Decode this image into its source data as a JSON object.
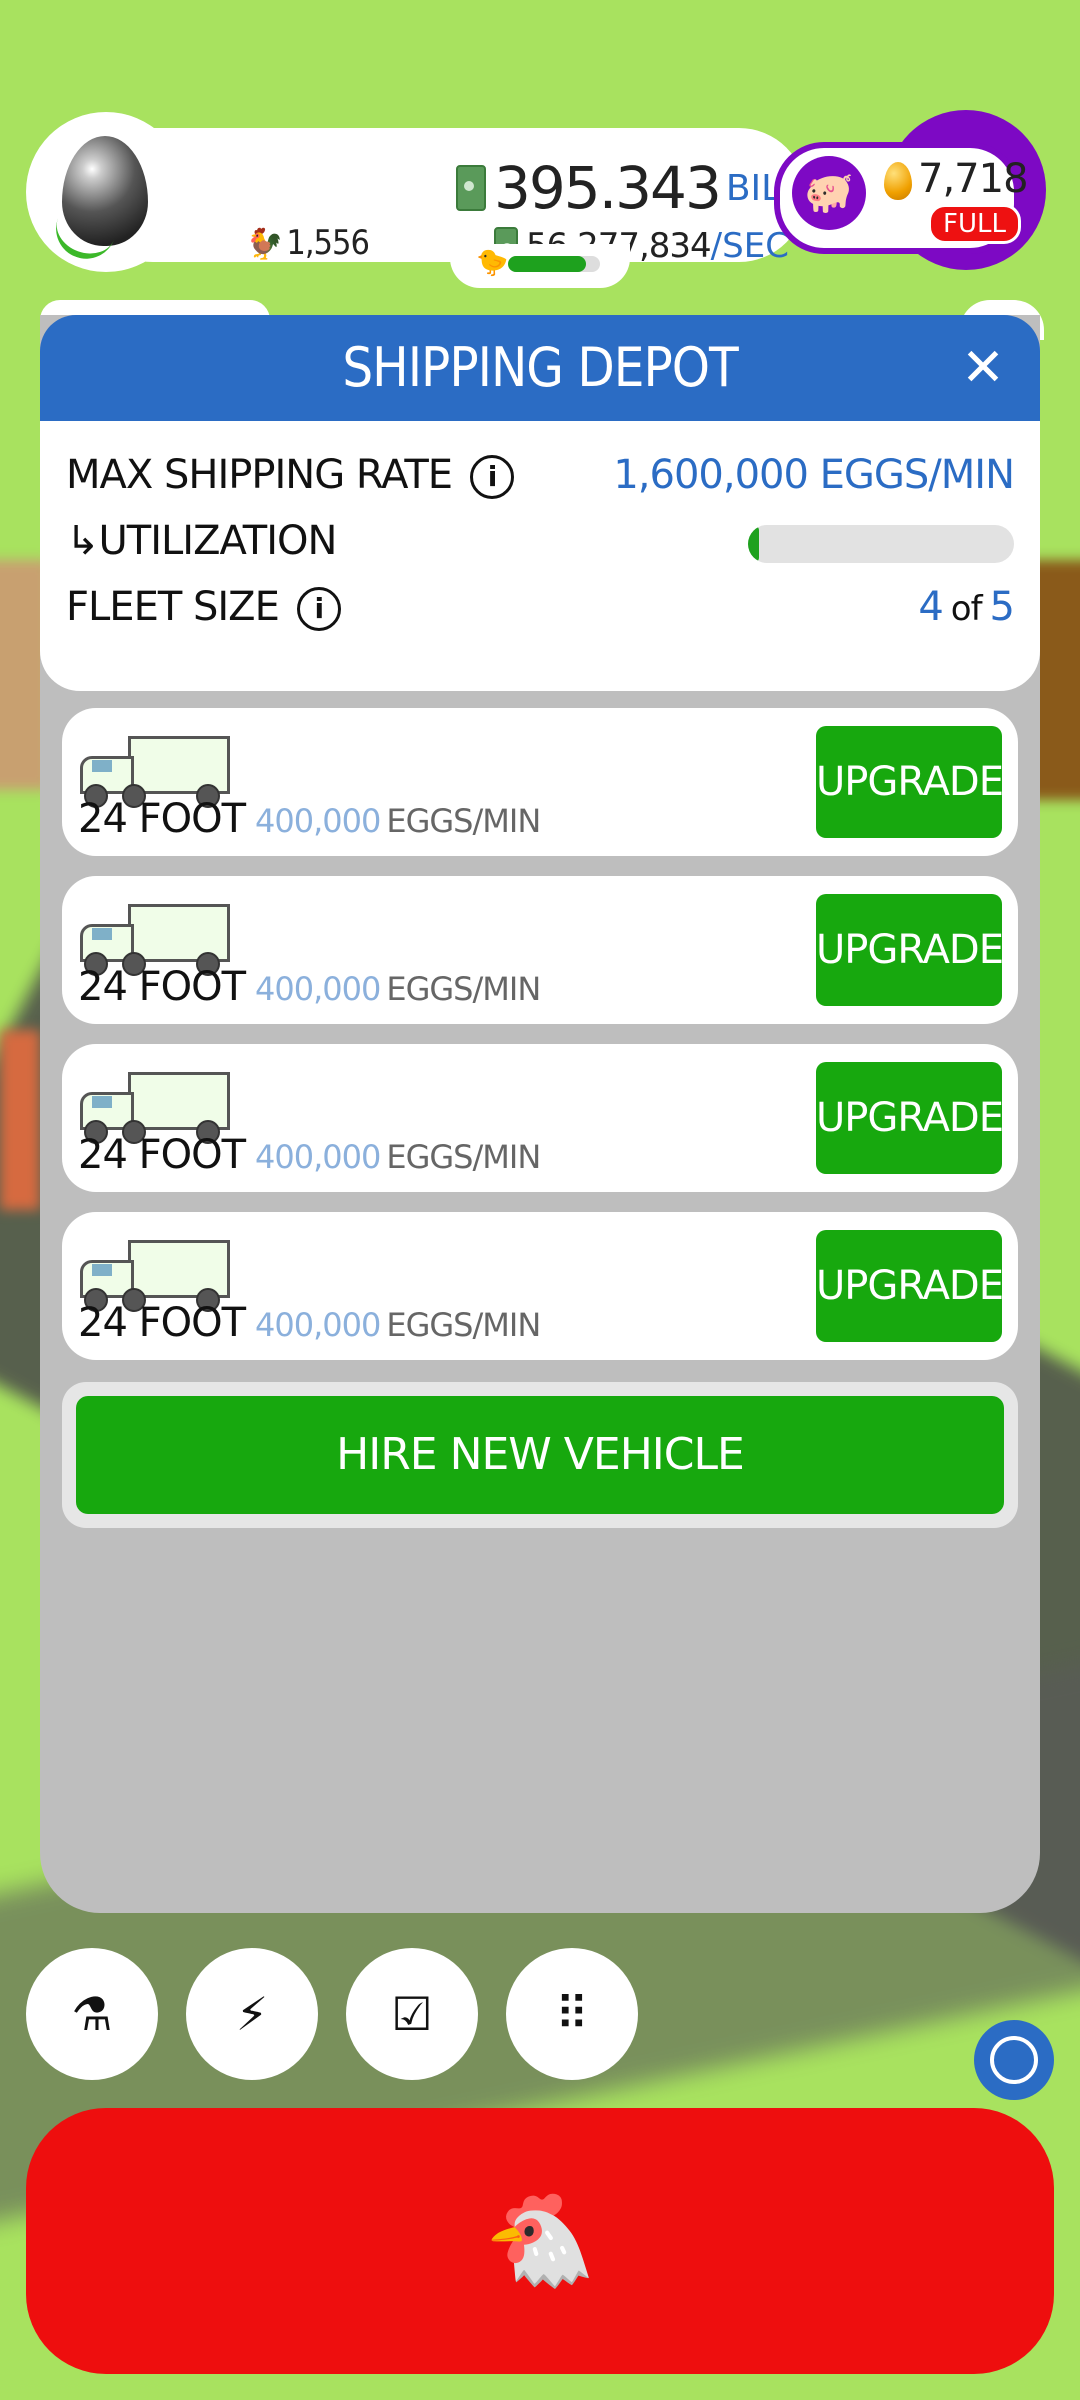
{
  "hud": {
    "chicken_count": "1,556",
    "money_value": "395.343",
    "money_unit": "BILLION",
    "rate_value": "56,277,834",
    "rate_unit": "/SEC",
    "golden_eggs": "7,718",
    "piggy_status": "FULL",
    "habitat_progress": 0.85
  },
  "modal": {
    "title": "SHIPPING DEPOT",
    "close_label": "✕",
    "max_rate_label": "MAX SHIPPING RATE",
    "max_rate_value": "1,600,000 EGGS/MIN",
    "utilization_label": "↳UTILIZATION",
    "utilization_fraction": 0.02,
    "fleet_label": "FLEET SIZE",
    "fleet_current": "4",
    "fleet_of": "of",
    "fleet_max": "5",
    "info_icon": "i",
    "vehicles": [
      {
        "name": "24 FOOT",
        "rate": "400,000",
        "unit": "EGGS/MIN",
        "button": "UPGRADE"
      },
      {
        "name": "24 FOOT",
        "rate": "400,000",
        "unit": "EGGS/MIN",
        "button": "UPGRADE"
      },
      {
        "name": "24 FOOT",
        "rate": "400,000",
        "unit": "EGGS/MIN",
        "button": "UPGRADE"
      },
      {
        "name": "24 FOOT",
        "rate": "400,000",
        "unit": "EGGS/MIN",
        "button": "UPGRADE"
      }
    ],
    "hire_button": "HIRE NEW VEHICLE"
  },
  "bottom": {
    "buttons": [
      {
        "icon": "flask-icon",
        "glyph": "⚗"
      },
      {
        "icon": "lightning-icon",
        "glyph": "⚡"
      },
      {
        "icon": "checklist-icon",
        "glyph": "☑"
      },
      {
        "icon": "grid-menu-icon",
        "glyph": "⠿"
      }
    ],
    "main_action_glyph": "🐔"
  },
  "colors": {
    "header_blue": "#2b6cc4",
    "upgrade_green": "#17a80e",
    "action_red": "#ee0e0e",
    "piggy_purple": "#7d09c4",
    "background_green": "#a8e25f"
  }
}
